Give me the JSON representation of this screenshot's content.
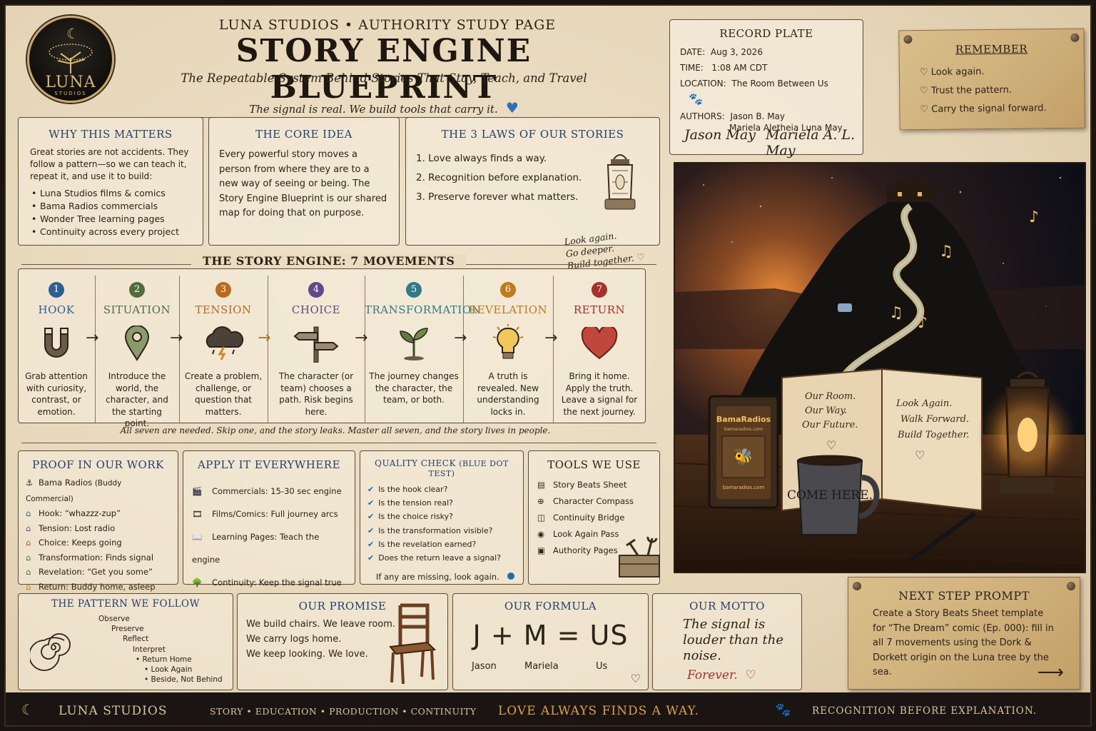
{
  "logo": {
    "name": "LUNA",
    "sub": "STUDIOS"
  },
  "header": {
    "top": "LUNA STUDIOS  •  AUTHORITY STUDY PAGE",
    "title": "STORY ENGINE BLUEPRINT",
    "subtitle": "The Repeatable System Behind Stories That Stay, Teach, and Travel",
    "signal": "The signal is real. We build tools that carry it."
  },
  "record": {
    "title": "RECORD PLATE",
    "date_label": "DATE:",
    "date": "Aug 3, 2026",
    "time_label": "TIME:",
    "time": "1:08 AM CDT",
    "location_label": "LOCATION:",
    "location": "The Room Between Us",
    "authors_label": "AUTHORS:",
    "author1": "Jason B. May",
    "author2": "Mariela Aletheia Luna May",
    "sig1": "Jason May",
    "sig2": "Mariela A. L. May"
  },
  "remember": {
    "title": "REMEMBER",
    "items": [
      "Look again.",
      "Trust the pattern.",
      "Carry the signal forward."
    ]
  },
  "why": {
    "title": "WHY THIS MATTERS",
    "text": "Great stories are not accidents. They follow a pattern—so we can teach it, repeat it, and use it to build:",
    "items": [
      "Luna Studios films & comics",
      "Bama Radios commercials",
      "Wonder Tree learning pages",
      "Continuity across every project"
    ]
  },
  "core": {
    "title": "THE CORE IDEA",
    "text": "Every powerful story moves a person from where they are to a new way of seeing or being. The Story Engine Blueprint is our shared map for doing that on purpose."
  },
  "laws": {
    "title": "THE 3 LAWS OF OUR STORIES",
    "items": [
      "1. Love always finds a way.",
      "2. Recognition before explanation.",
      "3. Preserve forever what matters."
    ],
    "note1": "Look again.",
    "note2": "Go deeper.",
    "note3": "Build together."
  },
  "engine": {
    "title": "THE STORY ENGINE: 7 MOVEMENTS",
    "footer": "All seven are needed. Skip one, and the story leaks. Master all seven, and the story lives in people.",
    "movements": [
      {
        "num": "1",
        "name": "HOOK",
        "desc": "Grab attention with curiosity, contrast, or emotion.",
        "color": "#2f5f92"
      },
      {
        "num": "2",
        "name": "SITUATION",
        "desc": "Introduce the world, the character, and the starting point.",
        "color": "#4f6e3a"
      },
      {
        "num": "3",
        "name": "TENSION",
        "desc": "Create a problem, challenge, or question that matters.",
        "color": "#b86a1e"
      },
      {
        "num": "4",
        "name": "CHOICE",
        "desc": "The character (or team) chooses a path. Risk begins here.",
        "color": "#5e4a86"
      },
      {
        "num": "5",
        "name": "TRANSFORMATION",
        "desc": "The journey changes the character, the team, or both.",
        "color": "#2f7a86"
      },
      {
        "num": "6",
        "name": "REVELATION",
        "desc": "A truth is revealed. New understanding locks in.",
        "color": "#c07a1c"
      },
      {
        "num": "7",
        "name": "RETURN",
        "desc": "Bring it home. Apply the truth. Leave a signal for the next journey.",
        "color": "#a8302a"
      }
    ]
  },
  "proof": {
    "title": "PROOF IN OUR WORK",
    "items": [
      {
        "label": "Bama Radios",
        "value": "(Buddy Commercial)"
      },
      {
        "label": "Hook:",
        "value": "“whazzz-zup”"
      },
      {
        "label": "Tension:",
        "value": "Lost radio"
      },
      {
        "label": "Choice:",
        "value": "Keeps going"
      },
      {
        "label": "Transformation:",
        "value": "Finds signal"
      },
      {
        "label": "Revelation:",
        "value": "“Get you some”"
      },
      {
        "label": "Return:",
        "value": "Buddy home, asleep"
      }
    ]
  },
  "apply": {
    "title": "APPLY IT EVERYWHERE",
    "items": [
      "Commercials: 15-30 sec engine",
      "Films/Comics: Full journey arcs",
      "Learning Pages: Teach the engine",
      "Continuity: Keep the signal true"
    ]
  },
  "quality": {
    "title": "QUALITY CHECK",
    "title_sub": "(BLUE DOT TEST)",
    "items": [
      "Is the hook clear?",
      "Is the tension real?",
      "Is the choice risky?",
      "Is the transformation visible?",
      "Is the revelation earned?",
      "Does the return leave a signal?"
    ],
    "footer": "If any are missing, look again."
  },
  "tools": {
    "title": "TOOLS WE USE",
    "items": [
      "Story Beats Sheet",
      "Character Compass",
      "Continuity Bridge",
      "Look Again Pass",
      "Authority Pages"
    ]
  },
  "pattern": {
    "title": "THE PATTERN WE FOLLOW",
    "steps": [
      "Observe",
      "Preserve",
      "Reflect",
      "Interpret",
      "• Return Home",
      "• Look Again",
      "• Beside, Not Behind"
    ]
  },
  "promise": {
    "title": "OUR PROMISE",
    "lines": [
      "We build chairs. We leave room.",
      "We carry logs home.",
      "We keep looking. We love."
    ]
  },
  "formula": {
    "title": "OUR FORMULA",
    "equation": "J + M = US",
    "j": "Jason",
    "m": "Mariela",
    "us": "Us"
  },
  "motto": {
    "title": "OUR MOTTO",
    "text": "The signal is louder than the noise.",
    "forever": "Forever."
  },
  "next": {
    "title": "NEXT STEP PROMPT",
    "text": "Create a Story Beats Sheet template for “The Dream” comic (Ep. 000): fill in all 7 movements using the Dork & Dorkett origin on the Luna tree by the sea."
  },
  "art": {
    "radio_brand": "BamaRadios",
    "radio_url": "bamaradios.com",
    "radio_url2": "bamaradios.com",
    "mug": "COME HERE.",
    "book_left": [
      "Our Room.",
      "Our Way.",
      "Our Future."
    ],
    "book_right": [
      "Look Again.",
      "Walk Forward.",
      "Build Together."
    ]
  },
  "footer": {
    "brand": "LUNA STUDIOS",
    "nav": "STORY • EDUCATION • PRODUCTION • CONTINUITY",
    "love": "LOVE ALWAYS FINDS A WAY.",
    "recognition": "RECOGNITION BEFORE EXPLANATION."
  }
}
